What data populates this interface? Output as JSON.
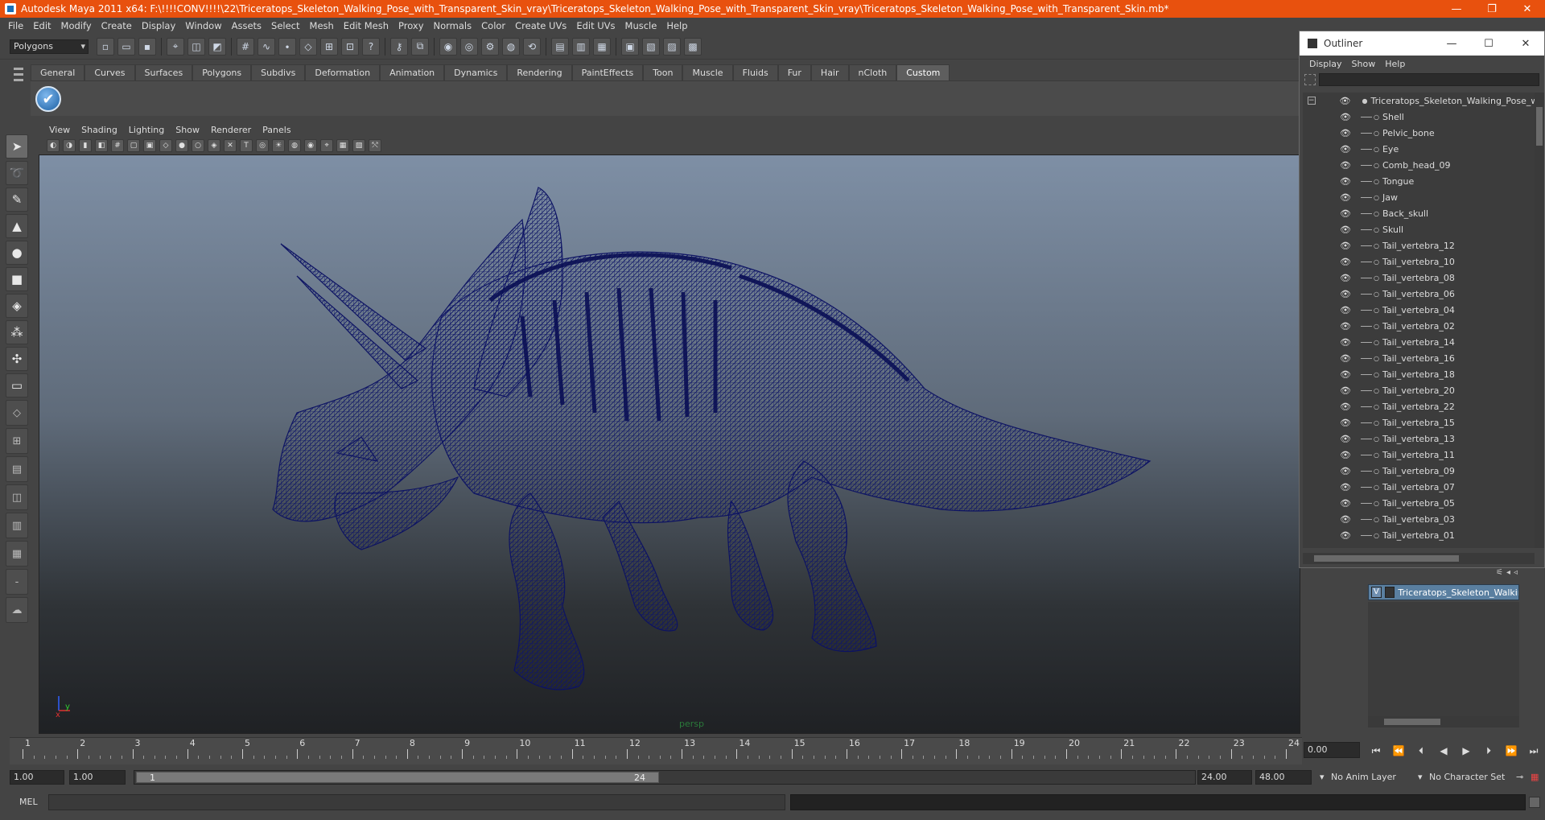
{
  "window": {
    "title": "Autodesk Maya 2011 x64: F:\\!!!!CONV!!!!\\22\\Triceratops_Skeleton_Walking_Pose_with_Transparent_Skin_vray\\Triceratops_Skeleton_Walking_Pose_with_Transparent_Skin_vray\\Triceratops_Skeleton_Walking_Pose_with_Transparent_Skin.mb*",
    "min_label": "—",
    "max_label": "❐",
    "close_label": "✕"
  },
  "menubar": [
    "File",
    "Edit",
    "Modify",
    "Create",
    "Display",
    "Window",
    "Assets",
    "Select",
    "Mesh",
    "Edit Mesh",
    "Proxy",
    "Normals",
    "Color",
    "Create UVs",
    "Edit UVs",
    "Muscle",
    "Help"
  ],
  "statusline": {
    "mode": "Polygons"
  },
  "shelf": {
    "tabs": [
      "General",
      "Curves",
      "Surfaces",
      "Polygons",
      "Subdivs",
      "Deformation",
      "Animation",
      "Dynamics",
      "Rendering",
      "PaintEffects",
      "Toon",
      "Muscle",
      "Fluids",
      "Fur",
      "Hair",
      "nCloth",
      "Custom"
    ],
    "active_tab": "Custom",
    "button_glyph": "✔"
  },
  "panel": {
    "menus": [
      "View",
      "Shading",
      "Lighting",
      "Show",
      "Renderer",
      "Panels"
    ],
    "camera": "persp",
    "axis_x": "x",
    "axis_y": "y"
  },
  "outliner": {
    "title": "Outliner",
    "menus": [
      "Display",
      "Show",
      "Help"
    ],
    "root": "Triceratops_Skeleton_Walking_Pose_with_Tr",
    "items": [
      "Shell",
      "Pelvic_bone",
      "Eye",
      "Comb_head_09",
      "Tongue",
      "Jaw",
      "Back_skull",
      "Skull",
      "Tail_vertebra_12",
      "Tail_vertebra_10",
      "Tail_vertebra_08",
      "Tail_vertebra_06",
      "Tail_vertebra_04",
      "Tail_vertebra_02",
      "Tail_vertebra_14",
      "Tail_vertebra_16",
      "Tail_vertebra_18",
      "Tail_vertebra_20",
      "Tail_vertebra_22",
      "Tail_vertebra_15",
      "Tail_vertebra_13",
      "Tail_vertebra_11",
      "Tail_vertebra_09",
      "Tail_vertebra_07",
      "Tail_vertebra_05",
      "Tail_vertebra_03",
      "Tail_vertebra_01"
    ],
    "min_label": "—",
    "max_label": "☐",
    "close_label": "✕"
  },
  "layers": {
    "name": "Triceratops_Skeleton_Walking_",
    "visible": "V"
  },
  "timeslider": {
    "ticks": [
      "1",
      "2",
      "3",
      "4",
      "5",
      "6",
      "7",
      "8",
      "9",
      "10",
      "11",
      "12",
      "13",
      "14",
      "15",
      "16",
      "17",
      "18",
      "19",
      "20",
      "21",
      "22",
      "23",
      "24"
    ],
    "current_time": "0.00"
  },
  "playback": [
    "⏮",
    "⏪",
    "⏴",
    "◀",
    "▶",
    "⏵",
    "⏩",
    "⏭"
  ],
  "range": {
    "start_time": "1.00",
    "playback_start": "1.00",
    "range_start": "1",
    "range_end": "24",
    "playback_end": "24.00",
    "end_time": "48.00",
    "anim_layer": "No Anim Layer",
    "character_set": "No Character Set"
  },
  "cmdline": {
    "label": "MEL"
  }
}
